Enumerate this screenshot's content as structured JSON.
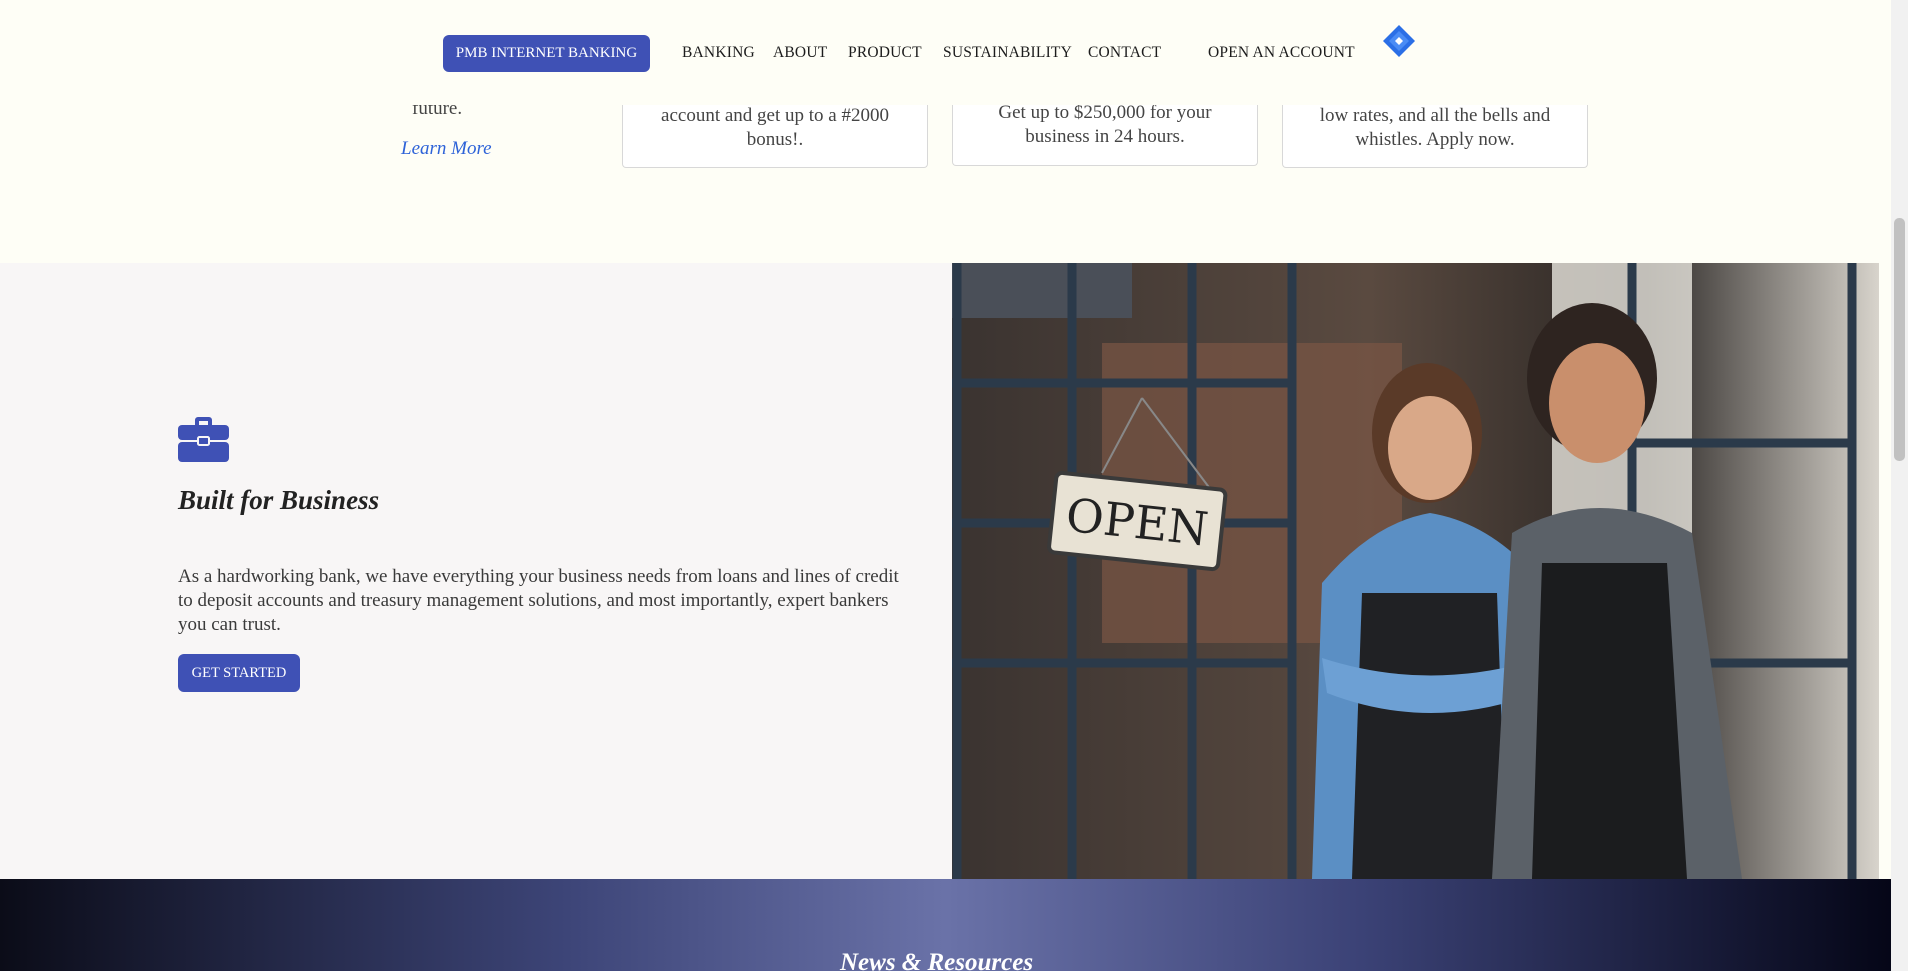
{
  "nav": {
    "ib_button": "PMB INTERNET BANKING",
    "links": [
      "BANKING",
      "ABOUT",
      "PRODUCT",
      "SUSTAINABILITY",
      "CONTACT"
    ],
    "open_account": "OPEN AN ACCOUNT"
  },
  "cards": {
    "col0_text": "future.",
    "learn_more": "Learn More",
    "card1": "account and get up to a #2000 bonus!.",
    "card2": "Get up to $250,000 for your business in 24 hours.",
    "card3": "low rates, and all the bells and whistles. Apply now."
  },
  "business": {
    "title": "Built for Business",
    "description": "As a hardworking bank, we have everything your business needs from loans and lines of credit to deposit accounts and treasury management solutions, and most importantly, expert bankers you can trust.",
    "cta": "GET STARTED",
    "icon": "briefcase-icon"
  },
  "photo": {
    "sign_text": "OPEN"
  },
  "news": {
    "title": "News & Resources"
  },
  "colors": {
    "primary": "#3f51b5",
    "link": "#2e63d8",
    "background": "#fefef6"
  }
}
